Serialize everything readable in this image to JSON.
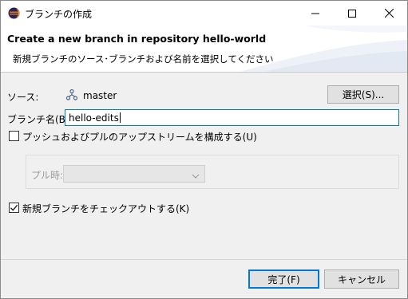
{
  "window": {
    "title": "ブランチの作成",
    "minimize": "minimize",
    "maximize": "maximize",
    "close": "close"
  },
  "header": {
    "title": "Create a new branch in repository hello-world",
    "description": "新規ブランチのソース･ブランチおよび名前を選択してください"
  },
  "form": {
    "source_label": "ソース:",
    "source_value": "master",
    "select_button": "選択(S)...",
    "branch_name_label": "ブランチ名(B):",
    "branch_name_value": "hello-edits",
    "configure_upstream_label": "プッシュおよびプルのアップストリームを構成する(U)",
    "configure_upstream_checked": false,
    "pull_label": "プル時:",
    "pull_value": "",
    "checkout_label": "新規ブランチをチェックアウトする(K)",
    "checkout_checked": true
  },
  "footer": {
    "finish_button": "完了(F)",
    "cancel_button": "キャンセル"
  },
  "colors": {
    "accent": "#0078d7",
    "header_bg": "#ffffff",
    "dialog_bg": "#f0f0f0"
  }
}
